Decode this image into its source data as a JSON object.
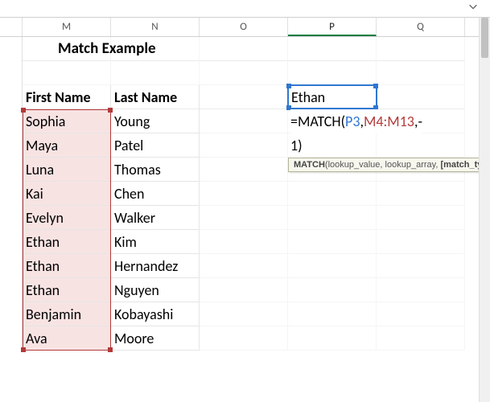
{
  "title": "Match Example",
  "columns": [
    "M",
    "N",
    "O",
    "P",
    "Q"
  ],
  "active_column": "P",
  "headers": {
    "first": "First Name",
    "last": "Last Name"
  },
  "lookup_value": "Ethan",
  "rows": [
    {
      "first": "Sophia",
      "last": "Young"
    },
    {
      "first": "Maya",
      "last": "Patel"
    },
    {
      "first": "Luna",
      "last": "Thomas"
    },
    {
      "first": "Kai",
      "last": "Chen"
    },
    {
      "first": "Evelyn",
      "last": "Walker"
    },
    {
      "first": "Ethan",
      "last": "Kim"
    },
    {
      "first": "Ethan",
      "last": "Hernandez"
    },
    {
      "first": "Ethan",
      "last": "Nguyen"
    },
    {
      "first": "Benjamin",
      "last": "Kobayashi"
    },
    {
      "first": "Ava",
      "last": "Moore"
    }
  ],
  "formula": {
    "prefix": "=MATCH(",
    "arg1": "P3",
    "sep1": ",",
    "arg2": "M4:M13",
    "sep2": ",",
    "line2_prefix": "-",
    "line2_suffix": "1)"
  },
  "tooltip": {
    "fn": "MATCH",
    "sig_open": "(",
    "a1": "lookup_value",
    "c1": ", ",
    "a2": "lookup_array",
    "c2": ", ",
    "a3": "[match_type]",
    "sig_close": ")"
  },
  "active_cell": "P4",
  "lookup_range": "M4:M13"
}
